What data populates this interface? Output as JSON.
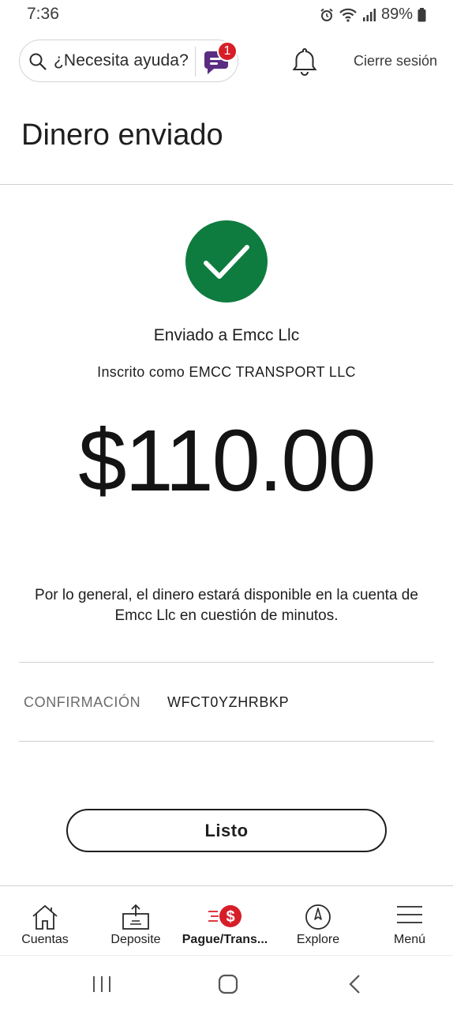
{
  "status_bar": {
    "time": "7:36",
    "battery": "89%",
    "icons": [
      "alarm-icon",
      "wifi-icon",
      "signal-icon",
      "battery-icon"
    ]
  },
  "header": {
    "search_placeholder": "¿Necesita ayuda?",
    "chat_badge_count": "1",
    "logout_label": "Cierre sesión"
  },
  "page": {
    "title": "Dinero enviado",
    "sent_to": "Enviado a Emcc Llc",
    "registered_as": "Inscrito como EMCC TRANSPORT LLC",
    "amount": "$110.00",
    "availability_note": "Por lo general, el dinero estará disponible en la cuenta de Emcc Llc en cuestión de minutos.",
    "confirmation_label": "CONFIRMACIÓN",
    "confirmation_number": "WFCT0YZHRBKP",
    "done_label": "Listo"
  },
  "tab_bar": {
    "items": [
      {
        "label": "Cuentas",
        "icon": "home-icon",
        "active": false
      },
      {
        "label": "Deposite",
        "icon": "deposit-check-icon",
        "active": false
      },
      {
        "label": "Pague/Trans...",
        "icon": "pay-transfer-icon",
        "active": true
      },
      {
        "label": "Explore",
        "icon": "compass-icon",
        "active": false
      },
      {
        "label": "Menú",
        "icon": "hamburger-menu-icon",
        "active": false
      }
    ]
  },
  "colors": {
    "brand_red": "#d71e28",
    "success_green": "#0e7c3f",
    "chat_purple": "#5a2d82"
  }
}
